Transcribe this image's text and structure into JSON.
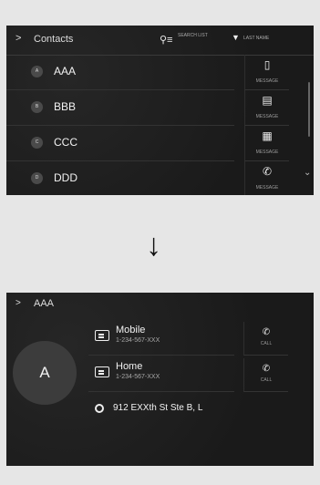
{
  "contacts_list": {
    "header": {
      "title": "Contacts",
      "search_label": "SEARCH LIST",
      "sort_label": "LAST NAME"
    },
    "rows": [
      {
        "initial": "A",
        "name": "AAA",
        "action_label": "MESSAGE",
        "action_icon": "mobile-icon"
      },
      {
        "initial": "B",
        "name": "BBB",
        "action_label": "MESSAGE",
        "action_icon": "message-icon"
      },
      {
        "initial": "C",
        "name": "CCC",
        "action_label": "MESSAGE",
        "action_icon": "calendar-message-icon"
      },
      {
        "initial": "D",
        "name": "DDD",
        "action_label": "MESSAGE",
        "action_icon": "phone-icon"
      }
    ]
  },
  "transition": {
    "arrow": "↓"
  },
  "contact_detail": {
    "header": {
      "title": "AAA"
    },
    "avatar_initial": "A",
    "phones": [
      {
        "type": "Mobile",
        "number": "1-234-567-XXX",
        "action_label": "CALL"
      },
      {
        "type": "Home",
        "number": "1-234-567-XXX",
        "action_label": "CALL"
      }
    ],
    "address": "912 EXXth St Ste B, L"
  }
}
